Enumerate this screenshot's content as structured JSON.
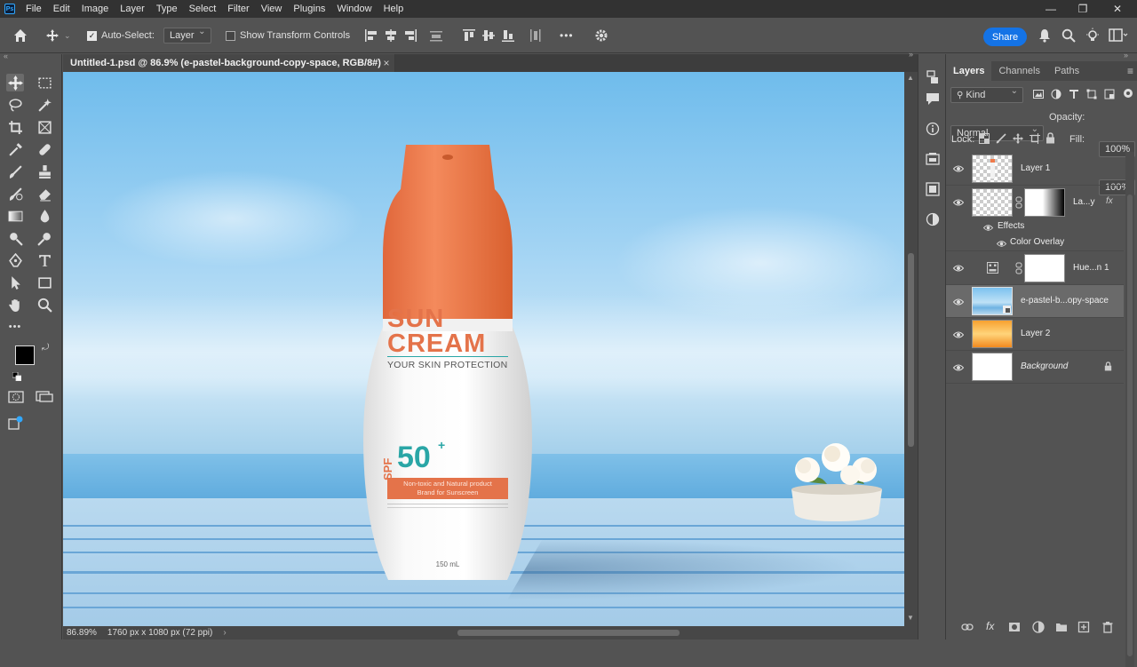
{
  "app": {
    "logo": "Ps"
  },
  "menu": [
    "File",
    "Edit",
    "Image",
    "Layer",
    "Type",
    "Select",
    "Filter",
    "View",
    "Plugins",
    "Window",
    "Help"
  ],
  "window_controls": {
    "minimize": "—",
    "restore": "❐",
    "close": "✕"
  },
  "options": {
    "auto_select_label": "Auto-Select:",
    "auto_select_checked": true,
    "layer_target": "Layer",
    "show_transform_label": "Show Transform Controls",
    "more": "•••",
    "share_label": "Share"
  },
  "document": {
    "tab_title": "Untitled-1.psd @ 86.9% (e-pastel-background-copy-space, RGB/8#)",
    "close": "×"
  },
  "status": {
    "zoom": "86.89%",
    "info": "1760 px x 1080 px (72 ppi)",
    "arrow": "›"
  },
  "layers_panel": {
    "tabs": [
      "Layers",
      "Channels",
      "Paths"
    ],
    "filter_kind": "Kind",
    "blend_mode": "Normal",
    "opacity_label": "Opacity:",
    "opacity_value": "100%",
    "lock_label": "Lock:",
    "fill_label": "Fill:",
    "fill_value": "100%",
    "fx": "fx",
    "effects_label": "Effects",
    "color_overlay_label": "Color Overlay",
    "layers": [
      {
        "name": "Layer 1"
      },
      {
        "name": "La...y"
      },
      {
        "name": "Hue...n 1"
      },
      {
        "name": "e-pastel-b...opy-space"
      },
      {
        "name": "Layer 2"
      },
      {
        "name": "Background"
      }
    ]
  },
  "product": {
    "brand_line1": "SUN",
    "brand_line2": "CREAM",
    "tagline": "YOUR SKIN PROTECTION",
    "spf_prefix": "SPF",
    "spf_value": "50",
    "spf_plus": "+",
    "banner_line1": "Non-toxic and Natural product",
    "banner_line2": "Brand for Sunscreen",
    "volume": "150 mL"
  },
  "colors": {
    "accent": "#1473e6",
    "cap": "#f07a4a",
    "brand_text": "#e4734a",
    "spf_teal": "#2aa6a6"
  }
}
